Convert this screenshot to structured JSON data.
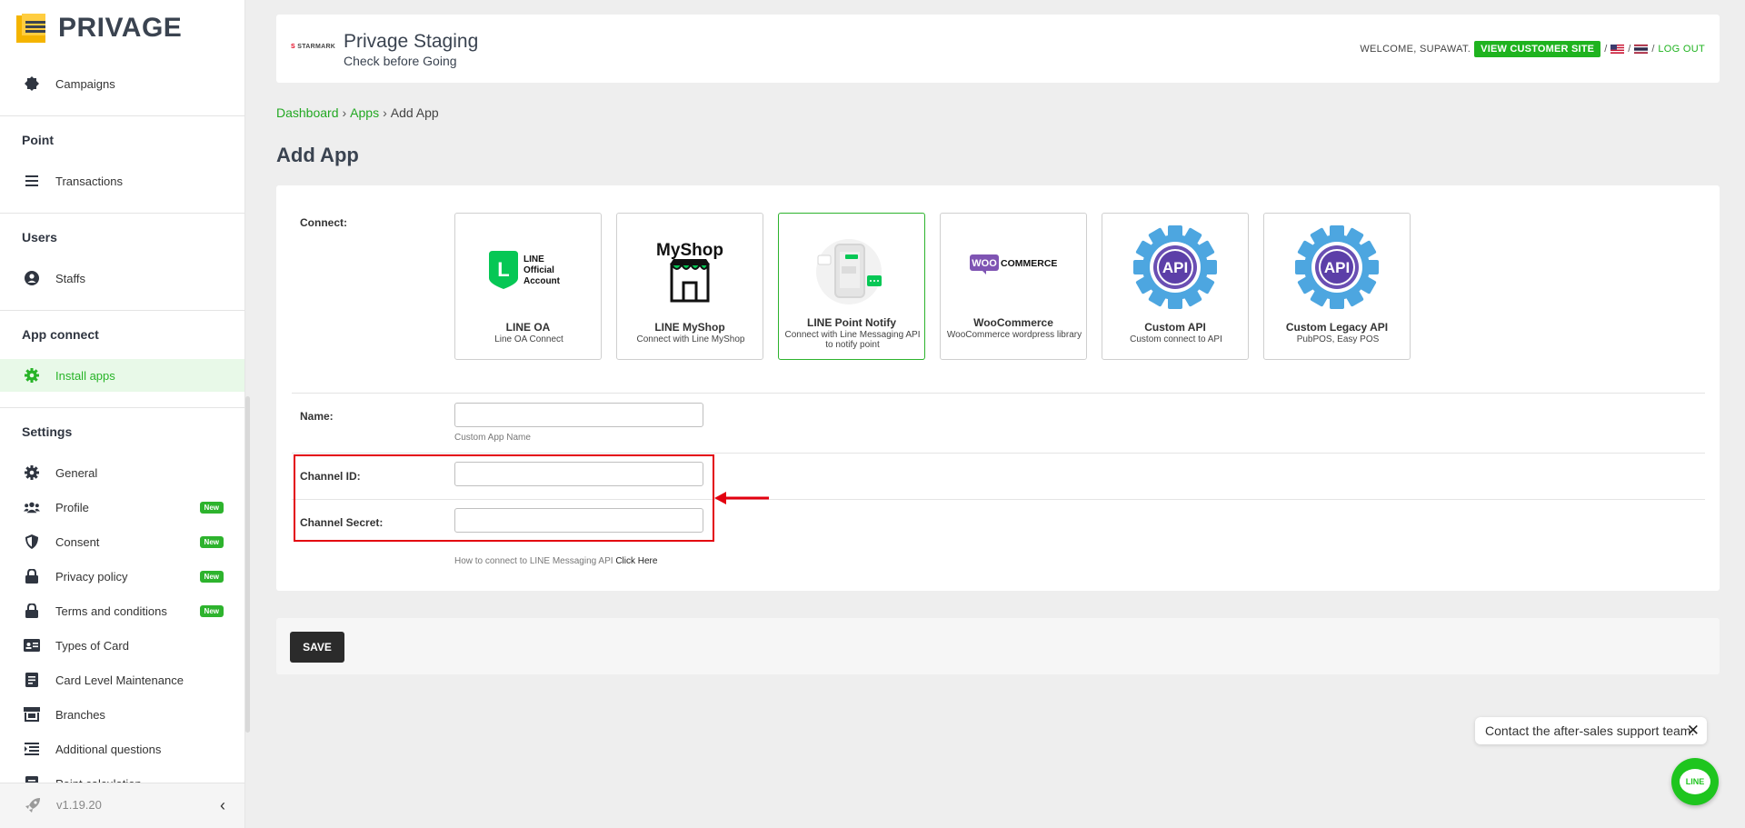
{
  "brand": {
    "name": "PRIVAGE",
    "accent": "#1fb31f"
  },
  "sidebar": {
    "items_top": [
      {
        "label": "Campaigns",
        "icon": "badge-icon"
      }
    ],
    "sections": [
      {
        "title": "Point",
        "items": [
          {
            "label": "Transactions",
            "icon": "list-icon"
          }
        ]
      },
      {
        "title": "Users",
        "items": [
          {
            "label": "Staffs",
            "icon": "user-circle-icon"
          }
        ]
      },
      {
        "title": "App connect",
        "items": [
          {
            "label": "Install apps",
            "icon": "gear-icon",
            "active": true
          }
        ]
      },
      {
        "title": "Settings",
        "items": [
          {
            "label": "General",
            "icon": "gear-icon"
          },
          {
            "label": "Profile",
            "icon": "users-icon",
            "badge": "New"
          },
          {
            "label": "Consent",
            "icon": "shield-icon",
            "badge": "New"
          },
          {
            "label": "Privacy policy",
            "icon": "lock-icon",
            "badge": "New"
          },
          {
            "label": "Terms and conditions",
            "icon": "lock-icon",
            "badge": "New"
          },
          {
            "label": "Types of Card",
            "icon": "id-card-icon"
          },
          {
            "label": "Card Level Maintenance",
            "icon": "document-icon"
          },
          {
            "label": "Branches",
            "icon": "store-icon"
          },
          {
            "label": "Additional questions",
            "icon": "list-indent-icon"
          },
          {
            "label": "Point calculation",
            "icon": "document-icon"
          }
        ]
      }
    ],
    "version": "v1.19.20"
  },
  "header": {
    "brand_logo_text": "STARMARK",
    "site_title": "Privage Staging",
    "site_subtitle": "Check before Going",
    "welcome": "WELCOME, SUPAWAT.",
    "view_site": "VIEW CUSTOMER SITE",
    "sep": "/",
    "logout": "LOG OUT"
  },
  "breadcrumb": {
    "dashboard": "Dashboard",
    "apps": "Apps",
    "current": "Add App",
    "sep": "›"
  },
  "page_title": "Add App",
  "form": {
    "connect_label": "Connect:",
    "apps": [
      {
        "name": "LINE OA",
        "desc": "Line OA Connect",
        "logo": "line-oa-logo",
        "logo_text": "LINE Official Account"
      },
      {
        "name": "LINE MyShop",
        "desc": "Connect with Line MyShop",
        "logo": "myshop-logo",
        "logo_text": "MyShop"
      },
      {
        "name": "LINE Point Notify",
        "desc": "Connect with Line Messaging API to notify point",
        "logo": "phone-notify-logo",
        "selected": true
      },
      {
        "name": "WooCommerce",
        "desc": "WooCommerce wordpress library",
        "logo": "woocommerce-logo",
        "logo_text": "WOOCOMMERCE"
      },
      {
        "name": "Custom API",
        "desc": "Custom connect to API",
        "logo": "api-gear-logo",
        "logo_text": "API"
      },
      {
        "name": "Custom Legacy API",
        "desc": "PubPOS, Easy POS",
        "logo": "api-gear-logo",
        "logo_text": "API"
      }
    ],
    "name_label": "Name:",
    "name_value": "",
    "name_hint": "Custom App Name",
    "channel_id_label": "Channel ID:",
    "channel_id_value": "",
    "channel_secret_label": "Channel Secret:",
    "channel_secret_value": "",
    "help_text": "How to connect to LINE Messaging API",
    "help_link": "Click Here",
    "highlight_color": "#e3000f"
  },
  "save_label": "SAVE",
  "support": {
    "text": "Contact the after-sales support team.",
    "close": "✕",
    "line_label": "LINE"
  }
}
